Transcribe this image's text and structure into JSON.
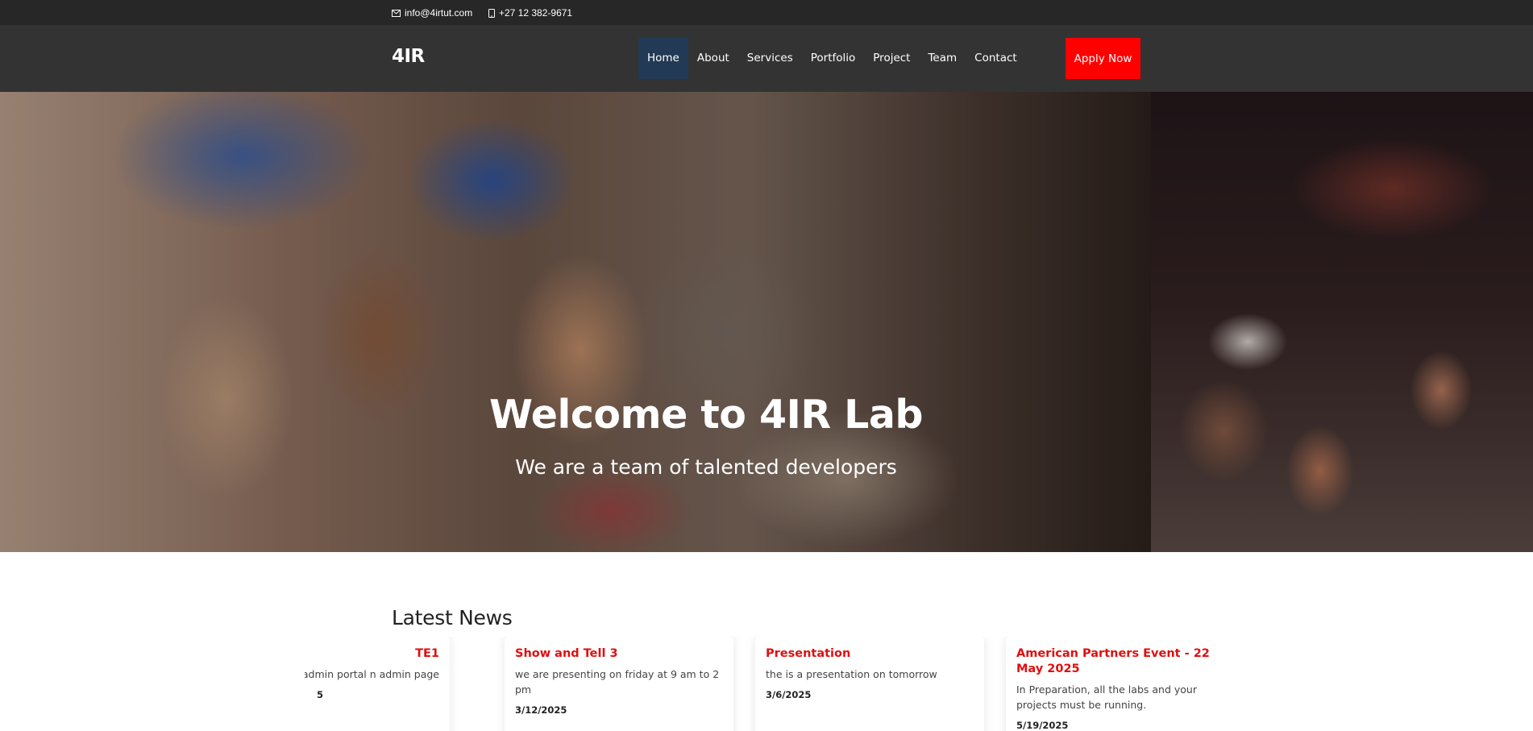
{
  "topbar": {
    "email": "info@4irtut.com",
    "email_icon": "envelope-icon",
    "phone": "+27 12 382-9671",
    "phone_icon": "mobile-phone-icon"
  },
  "header": {
    "logo": "4IR",
    "nav": [
      {
        "label": "Home",
        "active": true
      },
      {
        "label": "About"
      },
      {
        "label": "Services"
      },
      {
        "label": "Portfolio"
      },
      {
        "label": "Project"
      },
      {
        "label": "Team"
      },
      {
        "label": "Contact"
      }
    ],
    "apply_label": "Apply Now"
  },
  "hero": {
    "title": "Welcome to 4IR Lab",
    "subtitle": "We are a team of talented developers"
  },
  "news": {
    "heading": "Latest News",
    "items": [
      {
        "title": "TE1",
        "description": "ng and admin portal n admin page",
        "date": "5"
      },
      {
        "title": "Show and Tell 3",
        "description": "we are presenting on friday at 9 am to 2 pm",
        "date": "3/12/2025"
      },
      {
        "title": "Presentation",
        "description": "the is a presentation on tomorrow",
        "date": "3/6/2025"
      },
      {
        "title": "American Partners Event - 22 May 2025",
        "description": "In Preparation, all the labs and your projects must be running.",
        "date": "5/19/2025"
      }
    ]
  },
  "colors": {
    "accent": "#ff0000",
    "news_title": "#e10e0e",
    "nav_active": "#223a55",
    "header_bg": "#333333",
    "topbar_bg": "#272727"
  }
}
